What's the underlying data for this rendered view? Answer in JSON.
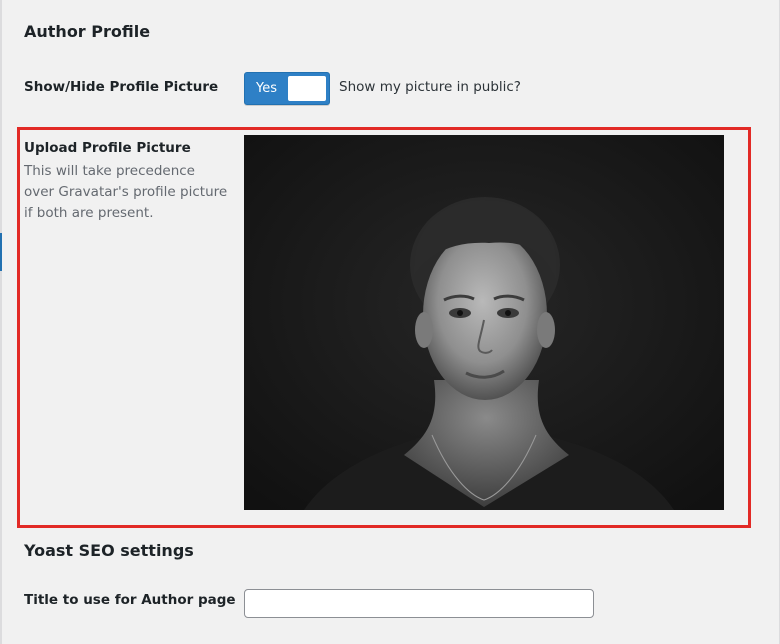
{
  "author_profile": {
    "title": "Author Profile",
    "show_hide": {
      "label": "Show/Hide Profile Picture",
      "toggle_value": "Yes",
      "toggle_state": "on",
      "description": "Show my picture in public?"
    },
    "upload": {
      "label": "Upload Profile Picture",
      "description": "This will take precedence over Gravatar's profile picture if both are present.",
      "image_alt": "Black and white portrait photo"
    }
  },
  "yoast": {
    "title": "Yoast SEO settings",
    "author_page_title": {
      "label": "Title to use for Author page",
      "value": ""
    }
  },
  "colors": {
    "accent": "#2271b1",
    "highlight": "#e22a26",
    "background": "#f1f1f1"
  }
}
